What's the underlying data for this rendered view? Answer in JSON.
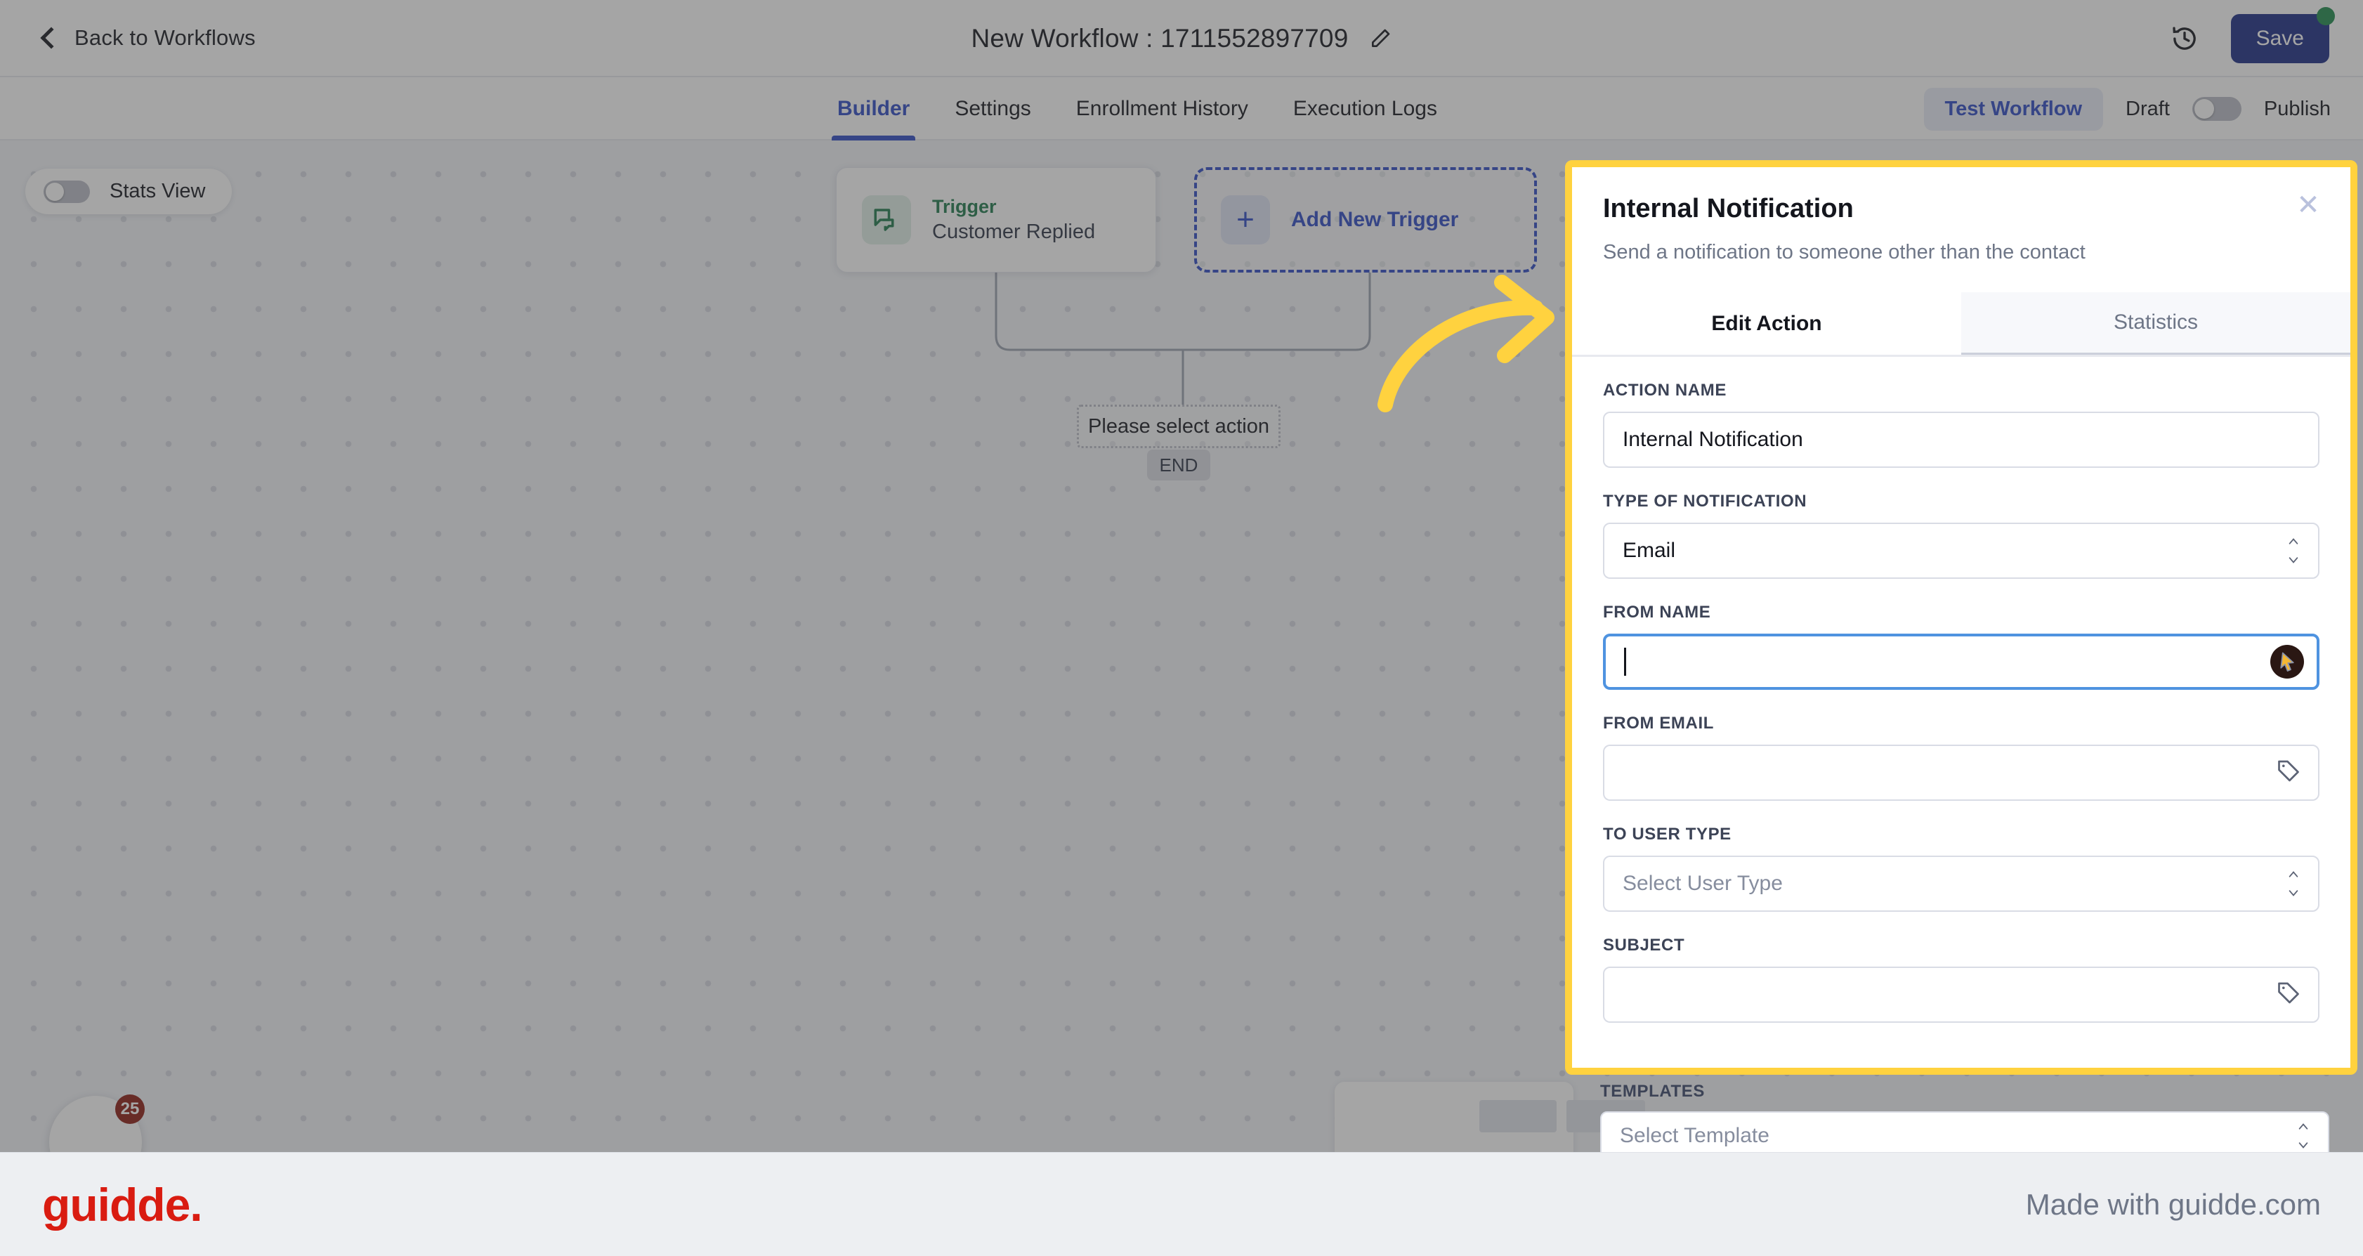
{
  "topbar": {
    "back_label": "Back to Workflows",
    "workflow_title": "New Workflow : 1711552897709",
    "edit_icon": "pencil-icon",
    "history_icon": "history-clock-icon",
    "save_label": "Save",
    "save_color": "#1b2c85",
    "status_dot_color": "#1f8a4c"
  },
  "tabbar": {
    "tabs": [
      {
        "label": "Builder",
        "active": true
      },
      {
        "label": "Settings",
        "active": false
      },
      {
        "label": "Enrollment History",
        "active": false
      },
      {
        "label": "Execution Logs",
        "active": false
      }
    ],
    "accent_color": "#2f4bc4",
    "test_workflow_label": "Test Workflow",
    "draft_label": "Draft",
    "publish_label": "Publish",
    "publish_toggle_on": false
  },
  "canvas": {
    "stats_view_label": "Stats View",
    "stats_view_on": false,
    "trigger_card": {
      "icon": "chat-bubble-icon",
      "kicker": "Trigger",
      "title": "Customer Replied",
      "kicker_color": "#1f7a4d"
    },
    "add_trigger": {
      "icon": "plus-icon",
      "label": "Add New Trigger"
    },
    "select_action_label": "Please select action",
    "end_label": "END",
    "badge_count": "25"
  },
  "panel": {
    "title": "Internal Notification",
    "subtitle": "Send a notification to someone other than the contact",
    "close_icon": "close-icon",
    "highlight_color": "#ffd23f",
    "tabs": [
      {
        "label": "Edit Action",
        "active": true
      },
      {
        "label": "Statistics",
        "active": false
      }
    ],
    "fields": [
      {
        "label": "ACTION NAME",
        "type": "text",
        "value": "Internal Notification",
        "placeholder": "",
        "focused": false,
        "icon": ""
      },
      {
        "label": "TYPE OF NOTIFICATION",
        "type": "select",
        "value": "Email",
        "placeholder": "",
        "focused": false,
        "icon": "chevron-updown-icon"
      },
      {
        "label": "FROM NAME",
        "type": "text",
        "value": "",
        "placeholder": "",
        "focused": true,
        "icon": "cursor-badge-icon"
      },
      {
        "label": "FROM EMAIL",
        "type": "text",
        "value": "",
        "placeholder": "",
        "focused": false,
        "icon": "tag-icon"
      },
      {
        "label": "TO USER TYPE",
        "type": "select",
        "value": "",
        "placeholder": "Select User Type",
        "focused": false,
        "icon": "chevron-updown-icon"
      },
      {
        "label": "SUBJECT",
        "type": "text",
        "value": "",
        "placeholder": "",
        "focused": false,
        "icon": "tag-icon"
      }
    ],
    "below": {
      "label": "TEMPLATES",
      "placeholder": "Select Template"
    }
  },
  "annotation": {
    "arrow": "curved-arrow-right"
  },
  "footer": {
    "logo_text": "guidde.",
    "logo_color": "#d91c11",
    "made_with": "Made with guidde.com"
  }
}
